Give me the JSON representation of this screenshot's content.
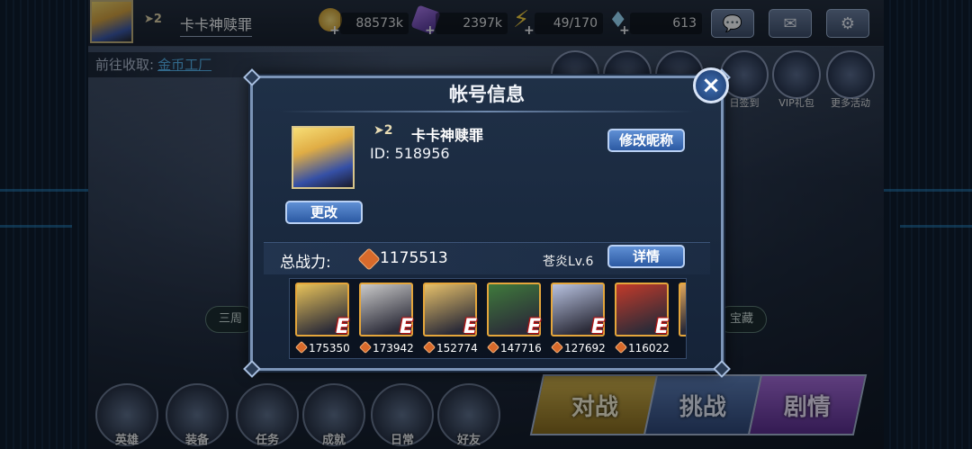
{
  "top": {
    "rank": "2",
    "player_name": "卡卡神赎罪",
    "gold": "88573k",
    "crystals": "2397k",
    "stamina": "49/170",
    "diamonds": "613",
    "plus": "+"
  },
  "goto": {
    "label": "前往收取:",
    "link": "金币工厂"
  },
  "activities": [
    "日签到",
    "VIP礼包",
    "更多活动"
  ],
  "bottom_menu": [
    "英雄",
    "装备",
    "任务",
    "成就",
    "日常",
    "好友"
  ],
  "modes": [
    "对战",
    "挑战",
    "剧情"
  ],
  "side_labels": {
    "left": "三周",
    "right": "宝藏"
  },
  "modal": {
    "title": "帐号信息",
    "close": "×",
    "rank": "2",
    "nickname": "卡卡神赎罪",
    "id_text": "ID: 518956",
    "rename_button": "修改昵称",
    "change_button": "更改",
    "power_label": "总战力:",
    "power_value": "1175513",
    "skin_level": "苍炎Lv.6",
    "details_button": "详情",
    "heroes": [
      {
        "grade": "E",
        "power": "175350",
        "color": "#e7c25a"
      },
      {
        "grade": "E",
        "power": "173942",
        "color": "#c9c9c9"
      },
      {
        "grade": "E",
        "power": "152774",
        "color": "#e6c06a"
      },
      {
        "grade": "E",
        "power": "147716",
        "color": "#3f7a3c"
      },
      {
        "grade": "E",
        "power": "127692",
        "color": "#b8c2e0"
      },
      {
        "grade": "E",
        "power": "116022",
        "color": "#c23a2a"
      }
    ]
  }
}
